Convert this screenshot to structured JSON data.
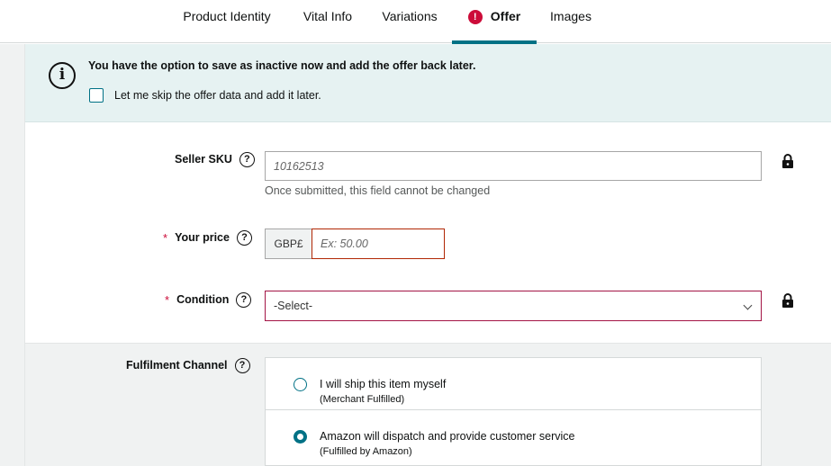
{
  "tabs": [
    {
      "label": "Product Identity"
    },
    {
      "label": "Vital Info"
    },
    {
      "label": "Variations"
    },
    {
      "label": "Offer",
      "active": true,
      "alert_icon": "exclamation-circle-icon",
      "alert_glyph": "!"
    },
    {
      "label": "Images"
    }
  ],
  "banner": {
    "icon": "info-icon",
    "icon_glyph": "i",
    "title": "You have the option to save as inactive now and add the offer back later.",
    "skip_label": "Let me skip the offer data and add it later."
  },
  "help_glyph": "?",
  "seller_sku": {
    "label": "Seller SKU",
    "value": "",
    "placeholder": "10162513",
    "hint": "Once submitted, this field cannot be changed"
  },
  "price": {
    "required_mark": "*",
    "label": "Your price",
    "currency": "GBP£",
    "value": "",
    "placeholder": "Ex: 50.00"
  },
  "condition": {
    "required_mark": "*",
    "label": "Condition",
    "selected": "-Select-"
  },
  "fulfilment": {
    "label": "Fulfilment Channel",
    "options": [
      {
        "title": "I will ship this item myself",
        "subtitle": "(Merchant Fulfilled)",
        "selected": false
      },
      {
        "title": "Amazon will dispatch and provide customer service",
        "subtitle": "(Fulfilled by Amazon)",
        "selected": true
      }
    ]
  },
  "colors": {
    "accent": "#007185",
    "error": "#cc0c39",
    "banner_bg": "#e6f2f2"
  }
}
